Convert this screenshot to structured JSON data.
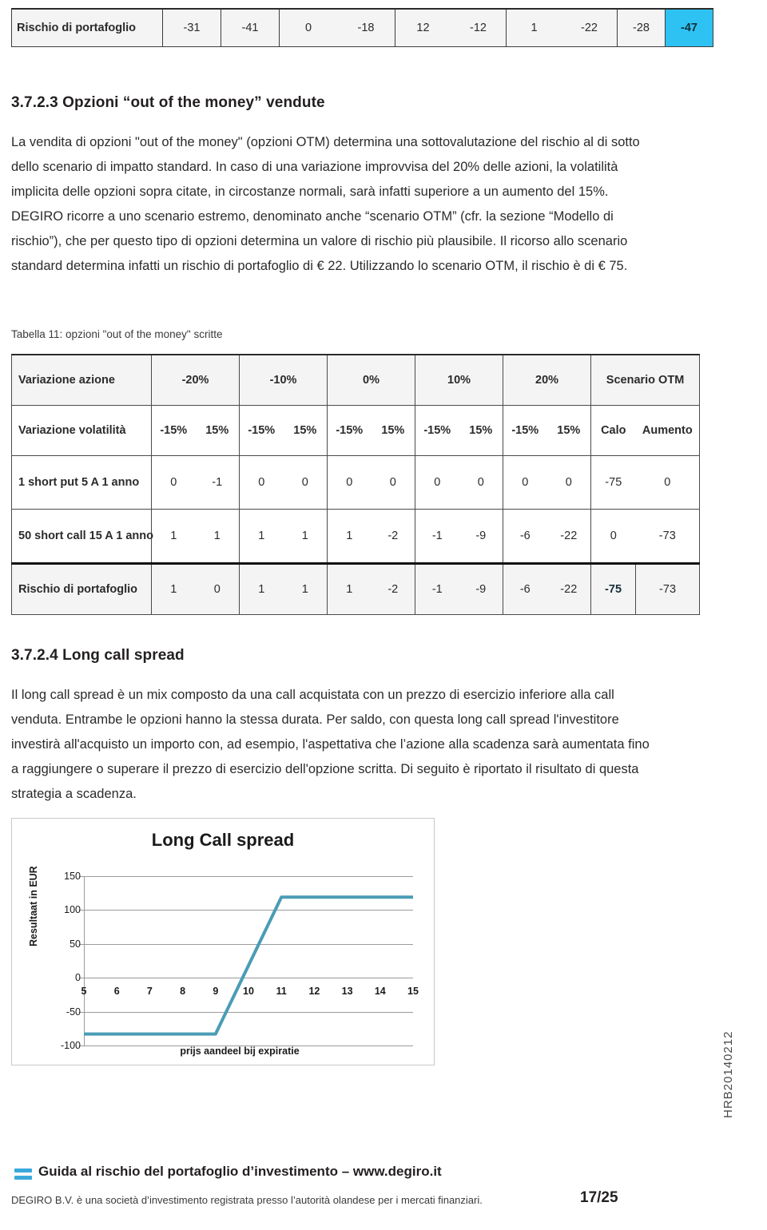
{
  "top_table": {
    "row_label": "Rischio di portafoglio",
    "values": [
      "-31",
      "-41",
      "0",
      "-18",
      "12",
      "-12",
      "1",
      "-22",
      "-28",
      "-47"
    ],
    "highlight_index": 9,
    "highlight_color": "#2ec2f3"
  },
  "section_1": {
    "heading": "3.7.2.3 Opzioni “out of the money” vendute",
    "paragraph": "La vendita di opzioni \"out of the money\" (opzioni OTM) determina una sottovalutazione del rischio al di sotto dello scenario di impatto standard. In caso di una variazione improvvisa del 20% delle azioni, la volatilità implicita delle opzioni sopra citate, in circostanze normali, sarà infatti superiore a un aumento del 15%. DEGIRO ricorre a uno scenario estremo, denominato anche “scenario OTM” (cfr. la sezione “Modello di rischio”), che per questo tipo di opzioni determina un valore di rischio più plausibile. Il ricorso allo scenario standard determina infatti un rischio di portafoglio di € 22. Utilizzando lo scenario OTM, il rischio è di € 75."
  },
  "table_caption": "Tabella 11: opzioni \"out of the money\" scritte",
  "main_table": {
    "header": {
      "label": "Variazione azione",
      "cells": [
        "-20%",
        "-10%",
        "0%",
        "10%",
        "20%",
        "Scenario OTM"
      ]
    },
    "subheader": {
      "label": "Variazione volatilità",
      "cells": [
        "-15%",
        "15%",
        "-15%",
        "15%",
        "-15%",
        "15%",
        "-15%",
        "15%",
        "-15%",
        "15%",
        "Calo",
        "Aumento"
      ]
    },
    "rows": [
      {
        "label": "1 short put 5 A 1 anno",
        "cells": [
          "0",
          "-1",
          "0",
          "0",
          "0",
          "0",
          "0",
          "0",
          "0",
          "0",
          "-75",
          "0"
        ]
      },
      {
        "label": "50 short call 15 A 1 anno",
        "cells": [
          "1",
          "1",
          "1",
          "1",
          "1",
          "-2",
          "-1",
          "-9",
          "-6",
          "-22",
          "0",
          "-73"
        ]
      }
    ],
    "total_row": {
      "label": "Rischio di portafoglio",
      "cells": [
        "1",
        "0",
        "1",
        "1",
        "1",
        "-2",
        "-1",
        "-9",
        "-6",
        "-22",
        "-75",
        "-73"
      ],
      "highlight_index": 10
    }
  },
  "section_2": {
    "heading": "3.7.2.4 Long call spread",
    "paragraph": "Il long call spread è un mix composto da una call acquistata con un prezzo di esercizio inferiore alla call venduta. Entrambe le opzioni hanno la stessa durata. Per saldo, con questa long call spread l'investitore investirà all'acquisto un importo con, ad esempio, l'aspettativa che l’azione alla scadenza sarà aumentata fino a raggiungere o superare il prezzo di esercizio dell'opzione scritta. Di seguito è riportato il risultato di questa strategia a scadenza."
  },
  "chart_data": {
    "type": "line",
    "title": "Long Call spread",
    "xlabel": "prijs aandeel bij expiratie",
    "ylabel": "Resultaat in EUR",
    "x": [
      5,
      6,
      7,
      8,
      9,
      10,
      11,
      12,
      13,
      14,
      15
    ],
    "values": [
      -83,
      -83,
      -83,
      -83,
      -83,
      18,
      119,
      119,
      119,
      119,
      119
    ],
    "series": [
      {
        "name": "Long Call spread",
        "values": [
          -83,
          -83,
          -83,
          -83,
          -83,
          18,
          119,
          119,
          119,
          119,
          119
        ]
      }
    ],
    "xtick_labels": [
      "5",
      "6",
      "7",
      "8",
      "9",
      "10",
      "11",
      "12",
      "13",
      "14",
      "15"
    ],
    "ytick_labels": [
      "150",
      "100",
      "50",
      "0",
      "-50",
      "-100"
    ],
    "yticks": [
      150,
      100,
      50,
      0,
      -50,
      -100
    ],
    "ylim": [
      -100,
      150
    ],
    "xlim": [
      5,
      15
    ],
    "grid": true,
    "legend": false,
    "line_color": "#4a9cb5"
  },
  "footer": {
    "title": "Guida al rischio del portafoglio d’investimento – www.degiro.it",
    "subtitle": "DEGIRO B.V. è una società d’investimento registrata presso l’autorità olandese per i mercati finanziari.",
    "page": "17/25",
    "side_code": "HRB20140212",
    "logo_color": "#39a9dc"
  }
}
